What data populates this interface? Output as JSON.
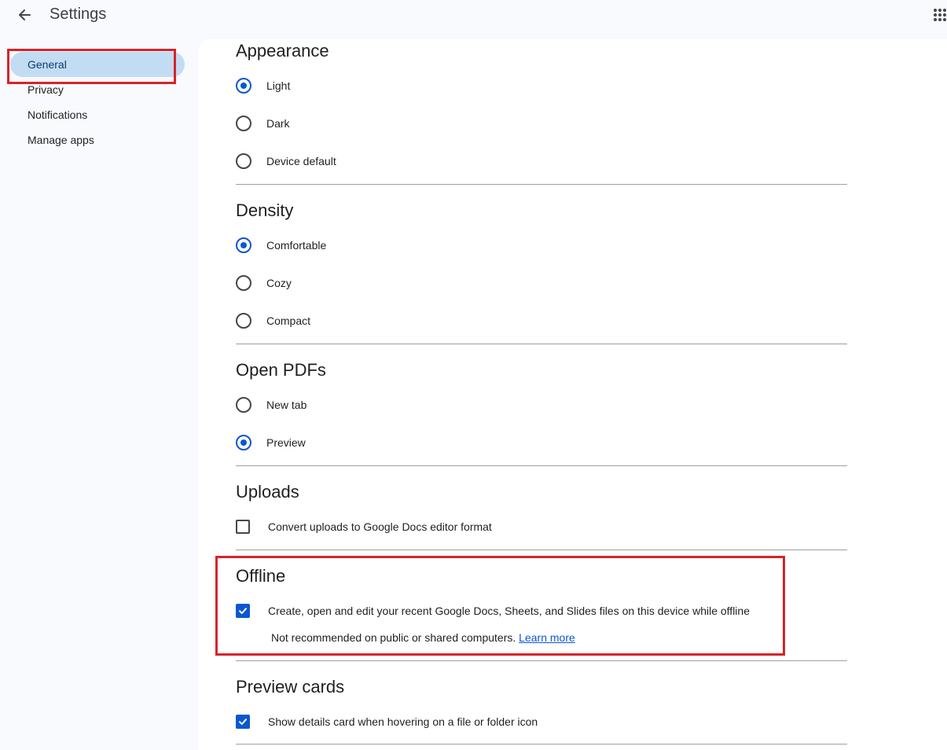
{
  "header": {
    "title": "Settings",
    "back_icon": "arrow-left-icon",
    "apps_icon": "grid-apps-icon"
  },
  "sidebar": {
    "items": [
      {
        "label": "General",
        "active": true
      },
      {
        "label": "Privacy",
        "active": false
      },
      {
        "label": "Notifications",
        "active": false
      },
      {
        "label": "Manage apps",
        "active": false
      }
    ]
  },
  "sections": {
    "appearance": {
      "title": "Appearance",
      "options": [
        {
          "label": "Light",
          "selected": true
        },
        {
          "label": "Dark",
          "selected": false
        },
        {
          "label": "Device default",
          "selected": false
        }
      ]
    },
    "density": {
      "title": "Density",
      "options": [
        {
          "label": "Comfortable",
          "selected": true
        },
        {
          "label": "Cozy",
          "selected": false
        },
        {
          "label": "Compact",
          "selected": false
        }
      ]
    },
    "open_pdfs": {
      "title": "Open PDFs",
      "options": [
        {
          "label": "New tab",
          "selected": false
        },
        {
          "label": "Preview",
          "selected": true
        }
      ]
    },
    "uploads": {
      "title": "Uploads",
      "checkbox_label": "Convert uploads to Google Docs editor format",
      "checked": false
    },
    "offline": {
      "title": "Offline",
      "checkbox_label": "Create, open and edit your recent Google Docs, Sheets, and Slides files on this device while offline",
      "checked": true,
      "note": "Not recommended on public or shared computers.",
      "learn_more": "Learn more"
    },
    "preview_cards": {
      "title": "Preview cards",
      "checkbox_label": "Show details card when hovering on a file or folder icon",
      "checked": true
    }
  },
  "colors": {
    "accent": "#0b57d0",
    "highlight": "#d8232a",
    "active_nav": "#c2dcf3"
  }
}
